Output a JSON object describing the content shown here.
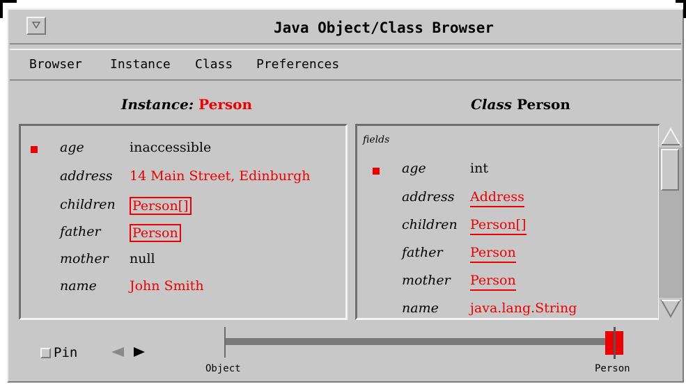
{
  "window": {
    "title": "Java Object/Class Browser"
  },
  "menubar": {
    "items": [
      "Browser",
      "Instance",
      "Class",
      "Preferences"
    ]
  },
  "instance_panel": {
    "heading_label": "Instance:",
    "heading_value": "Person",
    "fields": [
      {
        "name": "age",
        "value": "inaccessible",
        "style": "plain-black",
        "marked": true
      },
      {
        "name": "address",
        "value": "14 Main Street, Edinburgh",
        "style": "plain-red",
        "marked": false
      },
      {
        "name": "children",
        "value": "Person[]",
        "style": "boxed-red",
        "marked": false
      },
      {
        "name": "father",
        "value": "Person",
        "style": "boxed-red",
        "marked": false
      },
      {
        "name": "mother",
        "value": "null",
        "style": "plain-black",
        "marked": false
      },
      {
        "name": "name",
        "value": "John Smith",
        "style": "plain-red",
        "marked": false
      }
    ]
  },
  "class_panel": {
    "heading_label": "Class",
    "heading_value": "Person",
    "section_label": "fields",
    "fields": [
      {
        "name": "age",
        "type": "int",
        "style": "plain-black",
        "marked": true
      },
      {
        "name": "address",
        "type": "Address",
        "style": "underline-red",
        "marked": false
      },
      {
        "name": "children",
        "type": "Person[]",
        "style": "underline-red",
        "marked": false
      },
      {
        "name": "father",
        "type": "Person",
        "style": "underline-red",
        "marked": false
      },
      {
        "name": "mother",
        "type": "Person",
        "style": "underline-red",
        "marked": false
      },
      {
        "name": "name",
        "type": "java.lang.String",
        "style": "plain-red",
        "marked": false
      }
    ]
  },
  "footer": {
    "pin_label": "Pin",
    "pin_checked": false,
    "back_icon": "left-triangle-icon",
    "forward_icon": "right-triangle-icon"
  },
  "hierarchy": {
    "start_label": "Object",
    "end_label": "Person",
    "current": "Person"
  },
  "colors": {
    "accent": "#ee0000",
    "background": "#c8c8c8"
  }
}
